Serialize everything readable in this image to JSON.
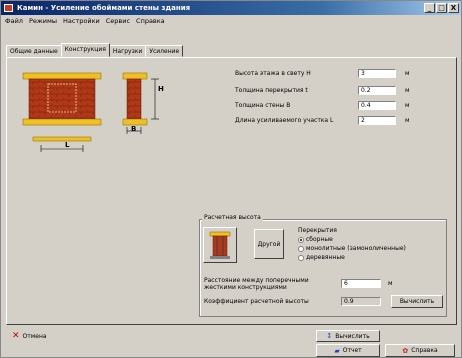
{
  "window": {
    "title": "Камин - Усиление обоймами стены здания",
    "controls": [
      "_",
      "□",
      "X"
    ]
  },
  "menu": [
    "Файл",
    "Режимы",
    "Настройки",
    "Сервис",
    "Справка"
  ],
  "tabs": [
    "Общие данные",
    "Конструкция",
    "Нагрузки",
    "Усиление"
  ],
  "active_tab": "Конструкция",
  "diagram": {
    "label_h": "H",
    "label_b": "B",
    "label_l": "L"
  },
  "fields": [
    {
      "label": "Высота этажа в свету H",
      "value": "3",
      "unit": "м"
    },
    {
      "label": "Толщина перекрытия t",
      "value": "0.2",
      "unit": "м"
    },
    {
      "label": "Толщина стены B",
      "value": "0.4",
      "unit": "м"
    },
    {
      "label": "Длина усиливаемого участка L",
      "value": "2",
      "unit": "м"
    }
  ],
  "calc_height": {
    "title": "Расчетная высота",
    "other_button": "Другой",
    "floors_title": "Перекрытия",
    "floor_options": [
      {
        "label": "сборные",
        "selected": true
      },
      {
        "label": "монолитные (замоноличенные)",
        "selected": false
      },
      {
        "label": "деревянные",
        "selected": false
      }
    ],
    "distance_label": "Расстояние между поперечными жесткими конструкциями",
    "distance_value": "6",
    "distance_unit": "м",
    "coef_label": "Коэффициент расчетной высоты",
    "coef_value": "0.9",
    "compute_button": "Вычислить"
  },
  "bottom": {
    "cancel": "Отмена",
    "compute": "Вычислить",
    "report": "Отчет",
    "help": "Справка"
  },
  "colors": {
    "brick": "#b03818",
    "brick_dark": "#8a2a10",
    "slab": "#f0c020",
    "title_start": "#0a246a",
    "title_end": "#a6caf0"
  }
}
